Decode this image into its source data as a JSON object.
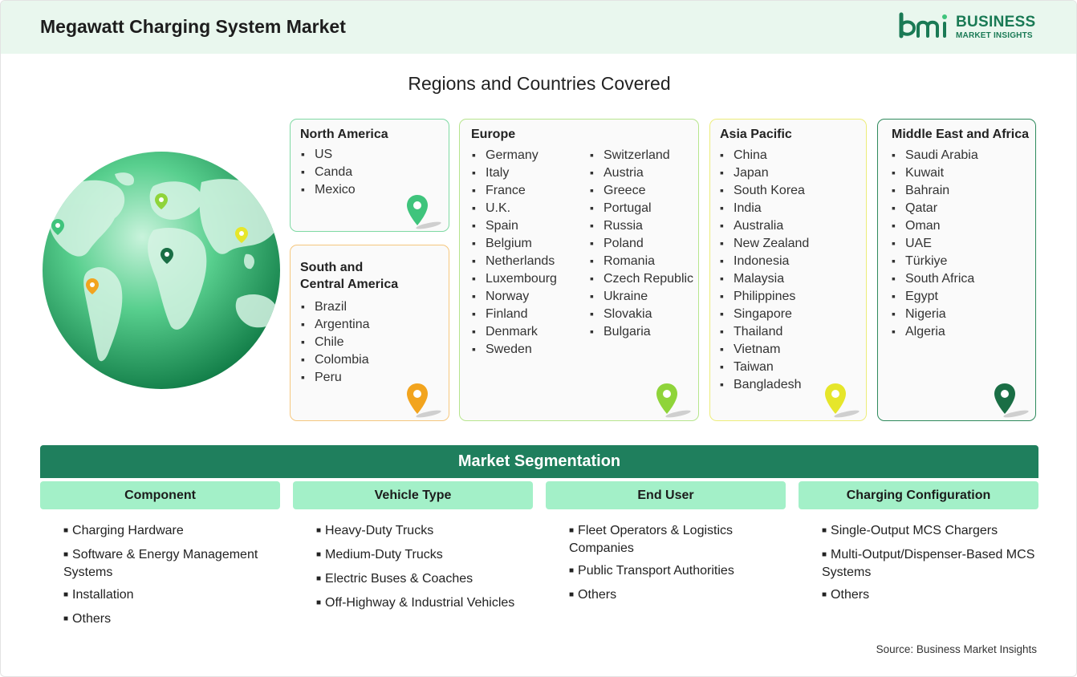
{
  "header": {
    "title": "Megawatt Charging System Market",
    "logo_line1": "BUSINESS",
    "logo_line2": "MARKET INSIGHTS",
    "logo_mark": "bmi"
  },
  "regions_section": {
    "title": "Regions and Countries Covered",
    "regions": [
      {
        "name": "North America",
        "pin_color": "#3fc47c",
        "countries": [
          "US",
          "Canda",
          "Mexico"
        ]
      },
      {
        "name": "South and Central America",
        "name_line1": "South and",
        "name_line2": "Central America",
        "pin_color": "#f2a41e",
        "countries": [
          "Brazil",
          "Argentina",
          "Chile",
          "Colombia",
          "Peru"
        ]
      },
      {
        "name": "Europe",
        "pin_color": "#8fd43a",
        "countries": [
          "Germany",
          "Italy",
          "France",
          "U.K.",
          "Spain",
          "Belgium",
          "Netherlands",
          "Luxembourg",
          "Norway",
          "Finland",
          "Denmark",
          "Sweden",
          "Switzerland",
          "Austria",
          "Greece",
          "Portugal",
          "Russia",
          "Poland",
          "Romania",
          "Czech Republic",
          "Ukraine",
          "Slovakia",
          "Bulgaria"
        ]
      },
      {
        "name": "Asia Pacific",
        "pin_color": "#e6e62a",
        "countries": [
          "China",
          "Japan",
          "South Korea",
          "India",
          "Australia",
          "New Zealand",
          "Indonesia",
          "Malaysia",
          "Philippines",
          "Singapore",
          "Thailand",
          "Vietnam",
          "Taiwan",
          "Bangladesh"
        ]
      },
      {
        "name": "Middle East and Africa",
        "pin_color": "#1a6e45",
        "countries": [
          "Saudi Arabia",
          "Kuwait",
          "Bahrain",
          "Qatar",
          "Oman",
          "UAE",
          "Türkiye",
          "South Africa",
          "Egypt",
          "Nigeria",
          "Algeria"
        ]
      }
    ]
  },
  "segmentation": {
    "title": "Market Segmentation",
    "columns": [
      {
        "header": "Component",
        "items": [
          "Charging Hardware",
          "Software & Energy Management Systems",
          "Installation",
          "Others"
        ]
      },
      {
        "header": "Vehicle Type",
        "items": [
          "Heavy-Duty Trucks",
          "Medium-Duty Trucks",
          "Electric Buses & Coaches",
          "Off-Highway & Industrial Vehicles"
        ]
      },
      {
        "header": "End User",
        "items": [
          "Fleet Operators & Logistics Companies",
          "Public Transport Authorities",
          "Others"
        ]
      },
      {
        "header": "Charging Configuration",
        "items": [
          "Single-Output MCS Chargers",
          "Multi-Output/Dispenser-Based MCS Systems",
          "Others"
        ]
      }
    ]
  },
  "source": "Source: Business Market Insights",
  "colors": {
    "header_bg": "#e9f7ee",
    "brand_green": "#1f7f5d",
    "segment_header_bg": "#a3f0c8",
    "card_border_north_america": "#7fd9a3",
    "card_border_south_america": "#f5c77e",
    "card_border_europe": "#b7e58d",
    "card_border_asia_pacific": "#eded7a",
    "card_border_mea": "#2e8a5c"
  },
  "icons": [
    "globe-illustration",
    "map-pin-icon"
  ]
}
